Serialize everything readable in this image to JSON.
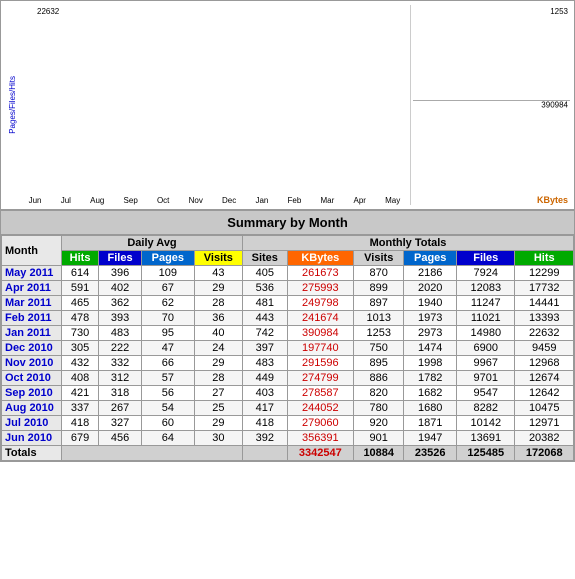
{
  "chart": {
    "title": "Summary by Month",
    "y_axis_label": "Pages/Files/Hits",
    "y_max": "22632",
    "y_right_max": "1253",
    "y_right_mid": "390984",
    "kbytes_label": "KBytes",
    "x_labels": [
      "Jun",
      "Jul",
      "Aug",
      "Sep",
      "Oct",
      "Nov",
      "Dec",
      "Jan",
      "Feb",
      "Mar",
      "Apr",
      "May"
    ]
  },
  "table": {
    "title": "Summary by Month",
    "headers": {
      "month": "Month",
      "daily_avg": "Daily Avg",
      "monthly_totals": "Monthly Totals",
      "hits": "Hits",
      "files": "Files",
      "pages": "Pages",
      "visits": "Visits",
      "sites": "Sites",
      "kbytes": "KBytes",
      "visits2": "Visits",
      "pages2": "Pages",
      "files2": "Files",
      "hits2": "Hits"
    },
    "rows": [
      {
        "month": "May 2011",
        "hits": "614",
        "files": "396",
        "pages": "109",
        "visits": "43",
        "sites": "405",
        "kbytes": "261673",
        "visits2": "870",
        "pages2": "2186",
        "files2": "7924",
        "hits2": "12299"
      },
      {
        "month": "Apr 2011",
        "hits": "591",
        "files": "402",
        "pages": "67",
        "visits": "29",
        "sites": "536",
        "kbytes": "275993",
        "visits2": "899",
        "pages2": "2020",
        "files2": "12083",
        "hits2": "17732"
      },
      {
        "month": "Mar 2011",
        "hits": "465",
        "files": "362",
        "pages": "62",
        "visits": "28",
        "sites": "481",
        "kbytes": "249798",
        "visits2": "897",
        "pages2": "1940",
        "files2": "11247",
        "hits2": "14441"
      },
      {
        "month": "Feb 2011",
        "hits": "478",
        "files": "393",
        "pages": "70",
        "visits": "36",
        "sites": "443",
        "kbytes": "241674",
        "visits2": "1013",
        "pages2": "1973",
        "files2": "11021",
        "hits2": "13393"
      },
      {
        "month": "Jan 2011",
        "hits": "730",
        "files": "483",
        "pages": "95",
        "visits": "40",
        "sites": "742",
        "kbytes": "390984",
        "visits2": "1253",
        "pages2": "2973",
        "files2": "14980",
        "hits2": "22632"
      },
      {
        "month": "Dec 2010",
        "hits": "305",
        "files": "222",
        "pages": "47",
        "visits": "24",
        "sites": "397",
        "kbytes": "197740",
        "visits2": "750",
        "pages2": "1474",
        "files2": "6900",
        "hits2": "9459"
      },
      {
        "month": "Nov 2010",
        "hits": "432",
        "files": "332",
        "pages": "66",
        "visits": "29",
        "sites": "483",
        "kbytes": "291596",
        "visits2": "895",
        "pages2": "1998",
        "files2": "9967",
        "hits2": "12968"
      },
      {
        "month": "Oct 2010",
        "hits": "408",
        "files": "312",
        "pages": "57",
        "visits": "28",
        "sites": "449",
        "kbytes": "274799",
        "visits2": "886",
        "pages2": "1782",
        "files2": "9701",
        "hits2": "12674"
      },
      {
        "month": "Sep 2010",
        "hits": "421",
        "files": "318",
        "pages": "56",
        "visits": "27",
        "sites": "403",
        "kbytes": "278587",
        "visits2": "820",
        "pages2": "1682",
        "files2": "9547",
        "hits2": "12642"
      },
      {
        "month": "Aug 2010",
        "hits": "337",
        "files": "267",
        "pages": "54",
        "visits": "25",
        "sites": "417",
        "kbytes": "244052",
        "visits2": "780",
        "pages2": "1680",
        "files2": "8282",
        "hits2": "10475"
      },
      {
        "month": "Jul 2010",
        "hits": "418",
        "files": "327",
        "pages": "60",
        "visits": "29",
        "sites": "418",
        "kbytes": "279060",
        "visits2": "920",
        "pages2": "1871",
        "files2": "10142",
        "hits2": "12971"
      },
      {
        "month": "Jun 2010",
        "hits": "679",
        "files": "456",
        "pages": "64",
        "visits": "30",
        "sites": "392",
        "kbytes": "356391",
        "visits2": "901",
        "pages2": "1947",
        "files2": "13691",
        "hits2": "20382"
      }
    ],
    "totals": {
      "label": "Totals",
      "kbytes": "3342547",
      "visits": "10884",
      "pages": "23526",
      "files": "125485",
      "hits": "172068"
    }
  }
}
